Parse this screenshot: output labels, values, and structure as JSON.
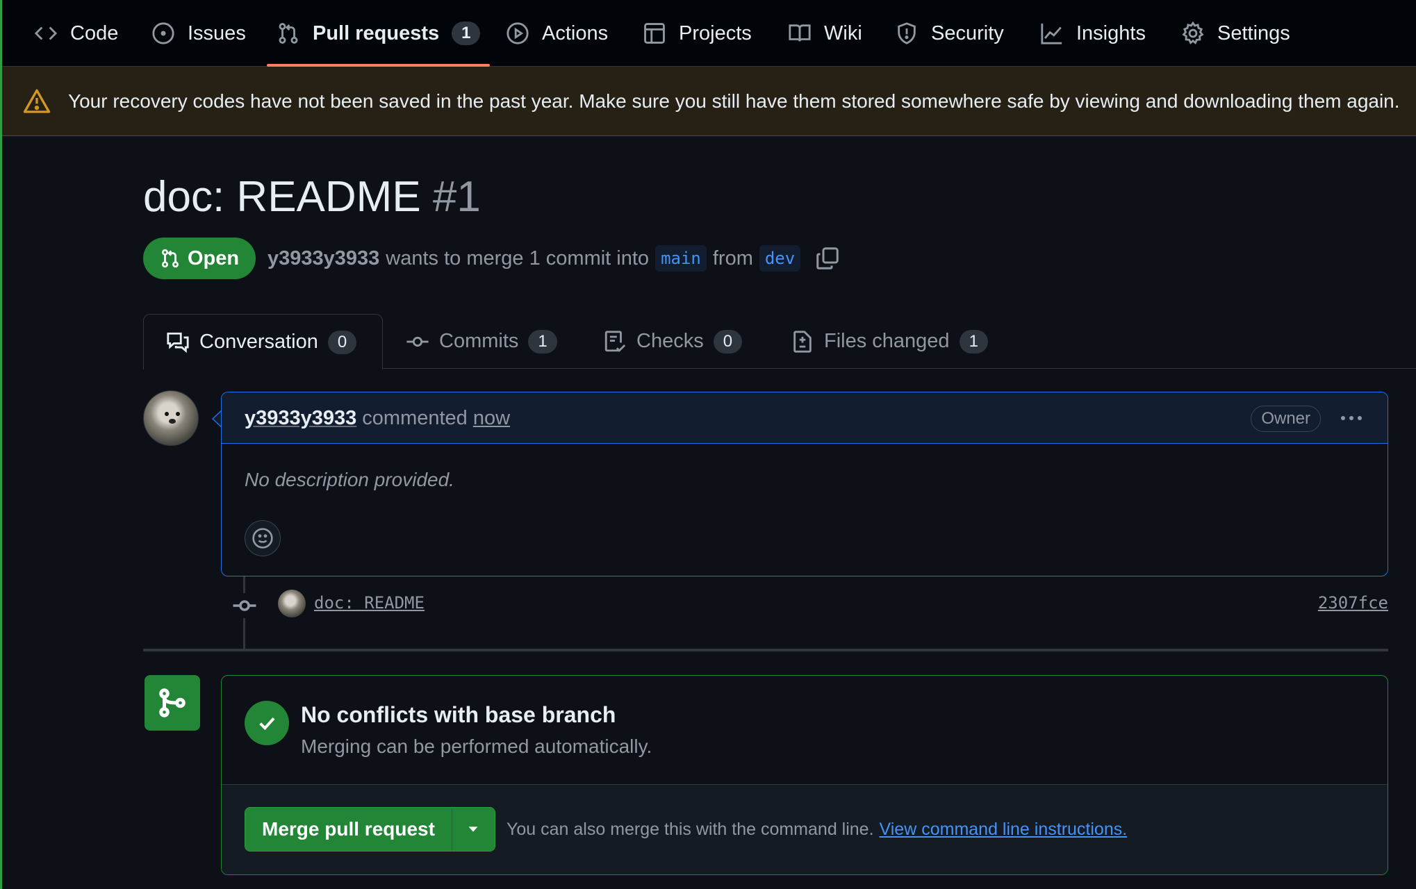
{
  "nav": {
    "items": [
      {
        "label": "Code",
        "icon": "code-icon"
      },
      {
        "label": "Issues",
        "icon": "issue-icon"
      },
      {
        "label": "Pull requests",
        "icon": "pull-request-icon",
        "count": "1",
        "active": true
      },
      {
        "label": "Actions",
        "icon": "play-icon"
      },
      {
        "label": "Projects",
        "icon": "table-icon"
      },
      {
        "label": "Wiki",
        "icon": "book-icon"
      },
      {
        "label": "Security",
        "icon": "shield-icon"
      },
      {
        "label": "Insights",
        "icon": "graph-icon"
      },
      {
        "label": "Settings",
        "icon": "gear-icon"
      }
    ]
  },
  "banner": {
    "icon": "alert-icon",
    "text": "Your recovery codes have not been saved in the past year. Make sure you still have them stored somewhere safe by viewing and downloading them again."
  },
  "pr": {
    "title": "doc: README",
    "number": "#1",
    "state": "Open",
    "author": "y3933y3933",
    "merge_text": "wants to merge 1 commit into",
    "base_branch": "main",
    "from_text": "from",
    "head_branch": "dev"
  },
  "tabs": [
    {
      "label": "Conversation",
      "count": "0",
      "icon": "comment-discussion-icon",
      "active": true
    },
    {
      "label": "Commits",
      "count": "1",
      "icon": "git-commit-icon"
    },
    {
      "label": "Checks",
      "count": "0",
      "icon": "checklist-icon"
    },
    {
      "label": "Files changed",
      "count": "1",
      "icon": "file-diff-icon"
    }
  ],
  "comment": {
    "author": "y3933y3933",
    "action": "commented",
    "time": "now",
    "badge": "Owner",
    "body": "No description provided."
  },
  "commit": {
    "message": "doc: README",
    "sha": "2307fce"
  },
  "merge": {
    "title": "No conflicts with base branch",
    "subtitle": "Merging can be performed automatically.",
    "button_label": "Merge pull request",
    "hint_text": "You can also merge this with the command line.",
    "hint_link": "View command line instructions."
  },
  "colors": {
    "accent_green": "#238636",
    "link_blue": "#4493f8",
    "tab_underline": "#f78166",
    "warning": "#d29922"
  }
}
